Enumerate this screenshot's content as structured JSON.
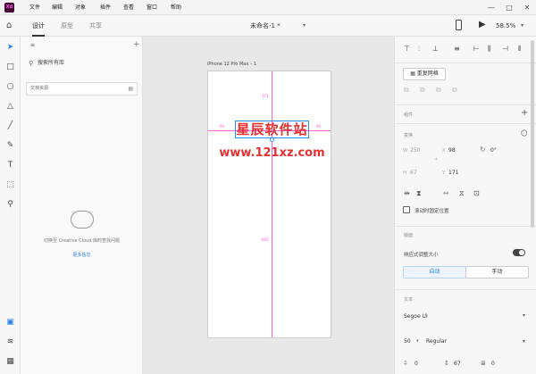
{
  "app": {
    "logo": "Xd"
  },
  "menu": [
    "文件",
    "编辑",
    "对象",
    "插件",
    "查看",
    "窗口",
    "帮助"
  ],
  "window_controls": [
    "—",
    "□",
    "✕"
  ],
  "toolbar": {
    "tabs": [
      "设计",
      "原型",
      "共享"
    ],
    "document_title": "未命名-1 *",
    "zoom": "58.5%"
  },
  "library": {
    "search_placeholder": "搜索所有库",
    "doc_assets": "文档资源",
    "cloud_message": "切换至 Creative Cloud 库时查找问题",
    "learn_more": "更多信息"
  },
  "canvas": {
    "artboard_label": "iPhone 12 Pro Max – 1",
    "guide_top": "171",
    "guide_left": "90",
    "guide_right": "90",
    "guide_bottom": "600",
    "text_main": "星辰软件站",
    "text_url": "www.121xz.com"
  },
  "inspector": {
    "repeat_grid": "重复网格",
    "component": "组件",
    "layout": "变换",
    "w": "250",
    "x": "98",
    "rotation": "0°",
    "h": "67",
    "y": "171",
    "fix_position": "滚动时固定位置",
    "layout_section": "版面",
    "responsive_resize": "响应式调整大小",
    "auto": "自动",
    "manual": "手动",
    "text_section": "文本",
    "font_family": "Segoe UI",
    "font_size": "50",
    "font_weight": "Regular",
    "char_spacing": "0",
    "line_spacing": "67",
    "para_spacing": "0"
  }
}
